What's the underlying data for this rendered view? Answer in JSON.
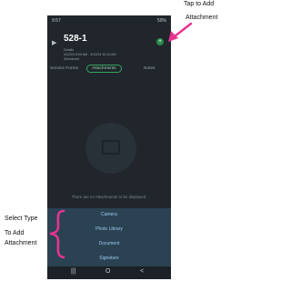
{
  "status_bar": {
    "time": "9:57",
    "battery": "59%"
  },
  "job": {
    "title": "528-1",
    "line1": "Details",
    "line2": "4/12/24 8:00 AM - 4/12/24 10:10 AM",
    "line3": "Scheduled"
  },
  "tabs": [
    {
      "label": "Service Forms",
      "active": false
    },
    {
      "label": "Attachments",
      "active": true
    },
    {
      "label": "Notes",
      "active": false
    }
  ],
  "empty_state": {
    "message": "There are no Attachments to be displayed."
  },
  "attachment_menu": {
    "options": [
      "Camera",
      "Photo Library",
      "Document",
      "Signature"
    ]
  },
  "nav_bar": {
    "recents": "|||",
    "home": "O",
    "back": "<"
  },
  "annotations": {
    "tap_to_add": [
      "Tap to Add",
      "Attachment"
    ],
    "select_type": [
      "Select Type",
      "To Add",
      "Attachment"
    ],
    "color": "#e6338f"
  },
  "colors": {
    "accent_green": "#37a35d",
    "sheet": "#2b4253",
    "background": "#20262c"
  },
  "icons": {
    "add": "plus-icon",
    "back": "back-arrow-icon",
    "empty": "attachment-placeholder-icon"
  }
}
